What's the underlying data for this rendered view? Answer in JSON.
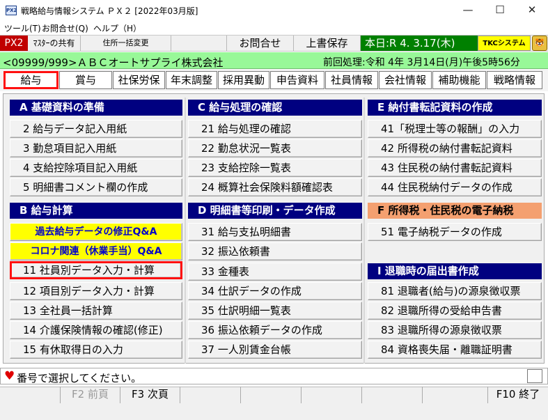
{
  "window": {
    "title": "戦略給与情報システム ＰＸ２ [2022年03月版]",
    "app_icon": "PX2",
    "minimize": "—",
    "maximize": "☐",
    "close": "✕"
  },
  "menubar": [
    "ツール(T)",
    "お問合せ(Q)",
    "ヘルプ（H）"
  ],
  "toolbar": {
    "badge": "PX2",
    "master_share": "ﾏｽﾀｰの共有",
    "address_change": "住所一括変更",
    "contact": "お問合せ",
    "save": "上書保存",
    "today": "本日:R 4. 3.17(木)",
    "tkc_qa": "TKCシステムQ&A"
  },
  "company_bar": {
    "company": "<09999/999>ＡＢＣオートサプライ株式会社",
    "previous": "前回処理:令和 4年 3月14日(月)午後5時56分"
  },
  "tabs": [
    "給与",
    "賞与",
    "社保労保",
    "年末調整",
    "採用異動",
    "申告資料",
    "社員情報",
    "会社情報",
    "補助機能",
    "戦略情報"
  ],
  "colA": {
    "header": "A 基礎資料の準備",
    "items": [
      "2 給与データ記入用紙",
      "3 勤怠項目記入用紙",
      "4 支給控除項目記入用紙",
      "5 明細書コメント欄の作成"
    ]
  },
  "colB": {
    "header": "B 給与計算",
    "qa1": "過去給与データの修正Q&A",
    "qa2": "コロナ関連（休業手当）Q&A",
    "items": [
      "11 社員別データ入力・計算",
      "12 項目別データ入力・計算",
      "13 全社員一括計算",
      "14 介護保険情報の確認(修正)",
      "15 有休取得日の入力"
    ]
  },
  "colC": {
    "header": "C 給与処理の確認",
    "items": [
      "21 給与処理の確認",
      "22 勤怠状況一覧表",
      "23 支給控除一覧表",
      "24 概算社会保険料額確認表"
    ]
  },
  "colD": {
    "header": "D 明細書等印刷・データ作成",
    "items": [
      "31 給与支払明細書",
      "32 振込依頼書",
      "33 金種表",
      "34 仕訳データの作成",
      "35 仕訳明細一覧表",
      "36 振込依頼データの作成",
      "37 一人別賃金台帳"
    ]
  },
  "colE": {
    "header": "E 納付書転記資料の作成",
    "items": [
      "41「税理士等の報酬」の入力",
      "42 所得税の納付書転記資料",
      "43 住民税の納付書転記資料",
      "44 住民税納付データの作成"
    ]
  },
  "colF": {
    "header": "F 所得税・住民税の電子納税",
    "items": [
      "51 電子納税データの作成"
    ]
  },
  "colI": {
    "header": "I 退職時の届出書作成",
    "items": [
      "81 退職者(給与)の源泉徴収票",
      "82 退職所得の受給申告書",
      "83 退職所得の源泉徴収票",
      "84 資格喪失届・離職証明書"
    ]
  },
  "status": {
    "heart": "♥",
    "text": "番号で選択してください。"
  },
  "fkeys": {
    "f2": "F2 前頁",
    "f3": "F3 次頁",
    "f10": "F10 終了"
  },
  "colors": {
    "section_header": "#000080",
    "orange_header": "#f4a070",
    "qa_bg": "#ffff00",
    "company_bar": "#98f898",
    "today_bg": "#008000",
    "badge_bg": "#c00000",
    "highlight": "#ff1010"
  }
}
